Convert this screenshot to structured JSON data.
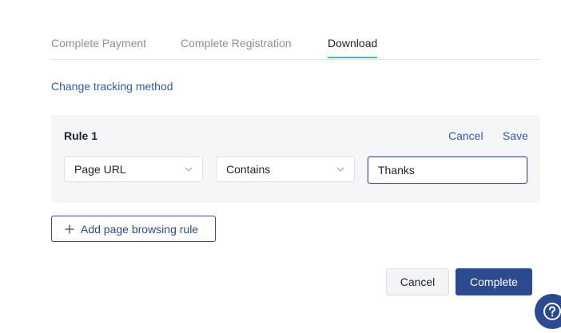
{
  "tabs": [
    {
      "label": "Complete Payment",
      "active": false
    },
    {
      "label": "Complete Registration",
      "active": false
    },
    {
      "label": "Download",
      "active": true
    }
  ],
  "change_tracking_link": "Change tracking method",
  "rule": {
    "title": "Rule 1",
    "cancel_label": "Cancel",
    "save_label": "Save",
    "field_select": "Page URL",
    "operator_select": "Contains",
    "value_input": "Thanks"
  },
  "add_rule_label": "Add page browsing rule",
  "footer": {
    "cancel_label": "Cancel",
    "complete_label": "Complete"
  },
  "colors": {
    "accent": "#2d4a8f",
    "link": "#2f5ba8",
    "tab_underline": "#2ec4c4"
  },
  "icons": [
    "chevron-down-icon",
    "plus-icon",
    "help-icon"
  ]
}
